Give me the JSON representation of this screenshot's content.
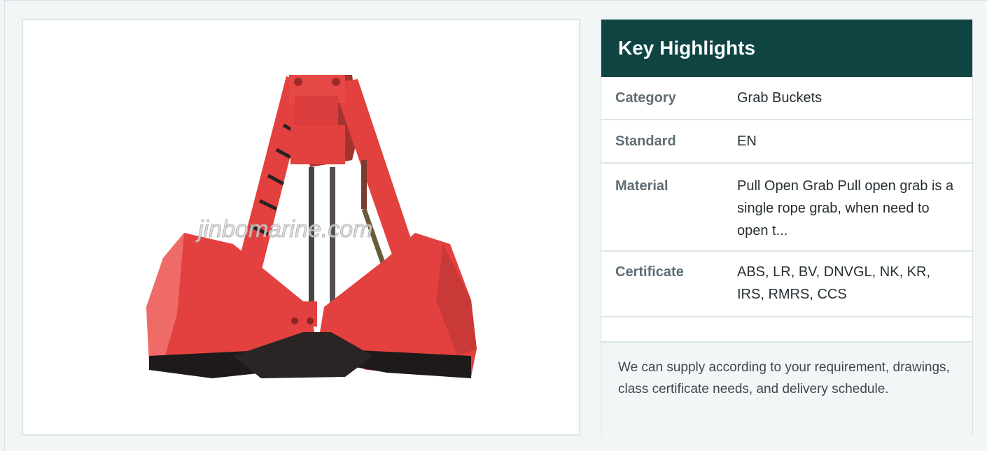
{
  "image": {
    "alt": "Grab bucket",
    "watermark": "jinbomarine.com"
  },
  "highlights": {
    "title": "Key Highlights",
    "rows": [
      {
        "key": "Category",
        "value": "Grab Buckets"
      },
      {
        "key": "Standard",
        "value": "EN"
      },
      {
        "key": "Material",
        "value": "Pull Open Grab Pull open grab is a single rope grab, when need to open t..."
      },
      {
        "key": "Certificate",
        "value": "ABS, LR, BV, DNVGL, NK, KR, IRS, RMRS, CCS"
      }
    ],
    "footer": "We can supply according to your requirement, drawings, class certificate needs, and delivery schedule."
  },
  "colors": {
    "header_bg": "#0f4443",
    "bucket_red": "#e0413f",
    "bucket_shadow": "#1e1a1a"
  }
}
